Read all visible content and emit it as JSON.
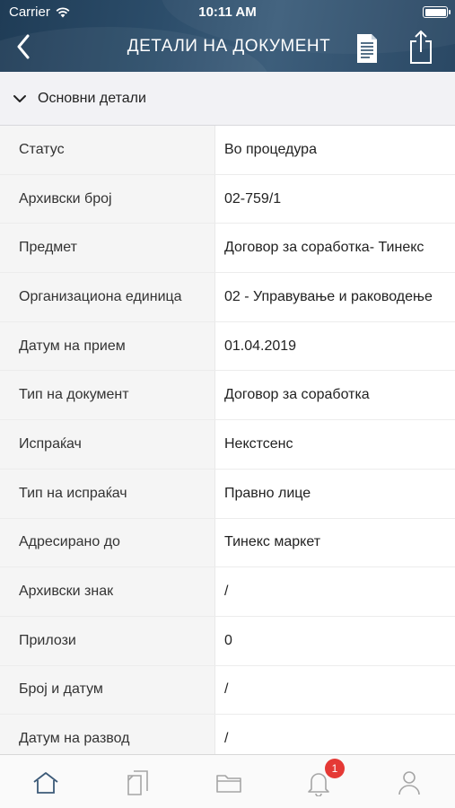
{
  "status_bar": {
    "carrier": "Carrier",
    "time": "10:11 AM"
  },
  "navbar": {
    "title": "ДЕТАЛИ НА ДОКУМЕНТ",
    "icons": [
      "back-chevron-icon",
      "document-icon",
      "share-icon"
    ]
  },
  "section": {
    "title": "Основни детали",
    "expanded": true
  },
  "details": [
    {
      "label": "Статус",
      "value": "Во процедура"
    },
    {
      "label": "Архивски број",
      "value": "02-759/1"
    },
    {
      "label": "Предмет",
      "value": "Договор за соработка- Тинекс"
    },
    {
      "label": "Организациона единица",
      "value": "02 - Управување и раководење"
    },
    {
      "label": "Датум на прием",
      "value": "01.04.2019"
    },
    {
      "label": "Тип на документ",
      "value": "Договор за соработка"
    },
    {
      "label": "Испраќач",
      "value": "Некстсенс"
    },
    {
      "label": "Тип на испраќач",
      "value": "Правно лице"
    },
    {
      "label": "Адресирано до",
      "value": "Тинекс маркет"
    },
    {
      "label": "Архивски знак",
      "value": "/"
    },
    {
      "label": "Прилози",
      "value": "0"
    },
    {
      "label": "Број и датум",
      "value": "/"
    },
    {
      "label": "Датум на развод",
      "value": "/"
    }
  ],
  "tabbar": {
    "tabs": [
      "home-icon",
      "documents-icon",
      "folder-icon",
      "bell-icon",
      "user-icon"
    ],
    "notification_badge": "1"
  },
  "colors": {
    "header": "#2c4d6a",
    "badge": "#e53935",
    "section_bg": "#f2f2f5"
  }
}
